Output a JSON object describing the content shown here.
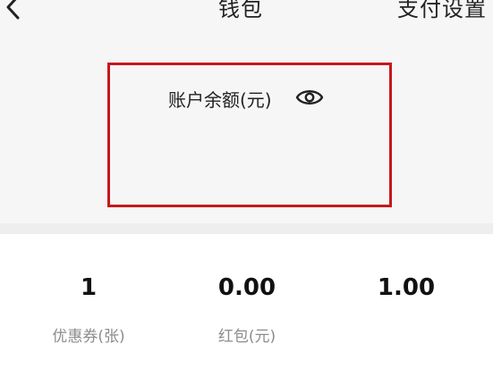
{
  "header": {
    "title": "钱包",
    "right_label": "支付设置"
  },
  "balance": {
    "label": "账户余额(元)"
  },
  "stats": [
    {
      "value": "1",
      "label": "优惠券(张)"
    },
    {
      "value": "0.00",
      "label": "红包(元)"
    },
    {
      "value": "1.00",
      "label": ""
    }
  ],
  "colors": {
    "highlight_border": "#c8161d",
    "label_gray": "#8c8c8c"
  },
  "icons": {
    "back": "chevron-left-icon",
    "eye": "eye-icon"
  }
}
